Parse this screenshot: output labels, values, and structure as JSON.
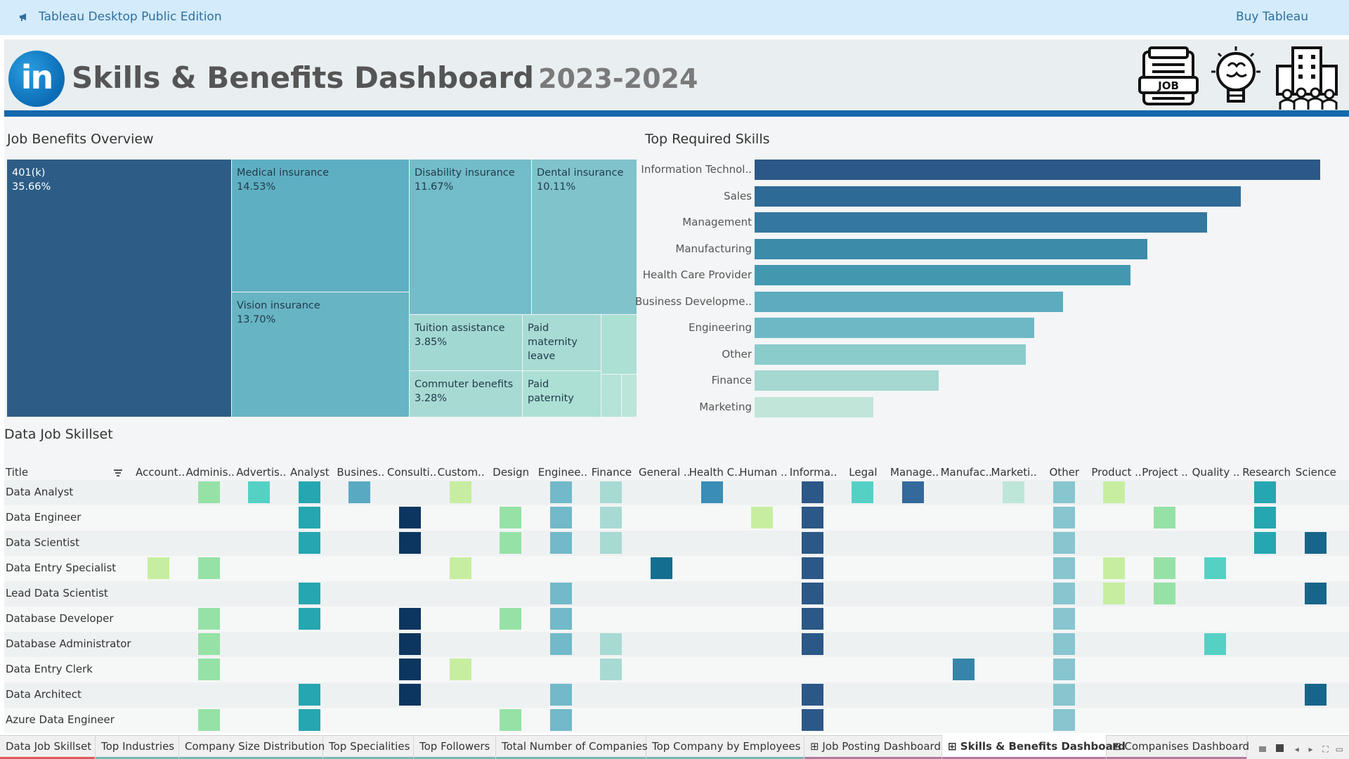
{
  "topbar": {
    "app_name": "Tableau Desktop Public Edition",
    "buy_label": "Buy Tableau"
  },
  "header": {
    "logo_text": "in",
    "title": "Skills & Benefits Dashboard",
    "years": "2023-2024",
    "icon_job_text": "JOB"
  },
  "benefits": {
    "title": "Job Benefits Overview",
    "tiles": [
      {
        "label": "401(k)",
        "value": "35.66%"
      },
      {
        "label": "Medical insurance",
        "value": "14.53%"
      },
      {
        "label": "Vision insurance",
        "value": "13.70%"
      },
      {
        "label": "Disability insurance",
        "value": "11.67%"
      },
      {
        "label": "Dental insurance",
        "value": "10.11%"
      },
      {
        "label": "Tuition assistance",
        "value": "3.85%"
      },
      {
        "label": "Commuter benefits",
        "value": "3.28%"
      },
      {
        "label": "Paid maternity leave",
        "value": ""
      },
      {
        "label": "Paid paternity",
        "value": ""
      }
    ]
  },
  "skills": {
    "title": "Top Required Skills",
    "chart_data": {
      "type": "bar",
      "orientation": "horizontal",
      "categories": [
        "Information Technol..",
        "Sales",
        "Management",
        "Manufacturing",
        "Health Care Provider",
        "Business Developme..",
        "Engineering",
        "Other",
        "Finance",
        "Marketing"
      ],
      "values": [
        100,
        86,
        80,
        69.5,
        66.5,
        54.5,
        49.5,
        48,
        32.5,
        21
      ],
      "colors": [
        "#2b5887",
        "#2e6a96",
        "#34779f",
        "#3b8ba9",
        "#4398b0",
        "#5cacbe",
        "#6eb8c5",
        "#8acbcb",
        "#a4d8d1",
        "#c1e6d9"
      ],
      "xlabel": "",
      "ylabel": "",
      "xlim": [
        0,
        100
      ],
      "grid": false
    }
  },
  "skillset": {
    "title": "Data Job Skillset",
    "title_col": "Title",
    "columns": [
      "Account..",
      "Adminis..",
      "Advertis..",
      "Analyst",
      "Busines..",
      "Consulti..",
      "Custom..",
      "Design",
      "Enginee..",
      "Finance",
      "General ..",
      "Health C..",
      "Human ..",
      "Informa..",
      "Legal",
      "Manage..",
      "Manufac..",
      "Marketi..",
      "Other",
      "Product ..",
      "Project ..",
      "Quality ..",
      "Research",
      "Science"
    ],
    "col_colors": [
      "#c7eea0",
      "#96e2a6",
      "#55d1c4",
      "#26a6b0",
      "#5aa9c3",
      "#0c3660",
      "#c7eea0",
      "#96e2a6",
      "#72b9ca",
      "#a7dad3",
      "#146e8f",
      "#3a8db6",
      "#c7eea0",
      "#2b5887",
      "#55d1c4",
      "#33699b",
      "#3685a8",
      "#bde6d9",
      "#87c5cf",
      "#c7eea0",
      "#96e2a6",
      "#55d1c4",
      "#26a6b0",
      "#17668a"
    ],
    "rows": [
      {
        "title": "Data Analyst",
        "cells": [
          1,
          2,
          3,
          4,
          6,
          8,
          9,
          11,
          13,
          14,
          15,
          17,
          18,
          19,
          22
        ]
      },
      {
        "title": "Data Engineer",
        "cells": [
          3,
          5,
          7,
          8,
          9,
          12,
          13,
          18,
          20,
          22
        ]
      },
      {
        "title": "Data Scientist",
        "cells": [
          3,
          5,
          7,
          8,
          9,
          13,
          18,
          22,
          23
        ]
      },
      {
        "title": "Data Entry Specialist",
        "cells": [
          0,
          1,
          6,
          10,
          13,
          18,
          19,
          20,
          21
        ]
      },
      {
        "title": "Lead Data Scientist",
        "cells": [
          3,
          8,
          13,
          18,
          19,
          20,
          23
        ]
      },
      {
        "title": "Database Developer",
        "cells": [
          1,
          3,
          5,
          7,
          8,
          13,
          18
        ]
      },
      {
        "title": "Database Administrator",
        "cells": [
          1,
          5,
          8,
          9,
          13,
          18,
          21
        ]
      },
      {
        "title": "Data Entry Clerk",
        "cells": [
          1,
          5,
          6,
          9,
          16,
          18
        ]
      },
      {
        "title": "Data Architect",
        "cells": [
          3,
          5,
          8,
          13,
          18,
          23
        ]
      },
      {
        "title": "Azure Data Engineer",
        "cells": [
          1,
          3,
          7,
          8,
          13,
          18
        ]
      }
    ]
  },
  "tabs": [
    {
      "label": "Data Job Skillset",
      "color": "#e15759"
    },
    {
      "label": "Top Industries",
      "color": "#76b7b2"
    },
    {
      "label": "Company Size Distribution",
      "color": "#76b7b2"
    },
    {
      "label": "Top Specialities",
      "color": "#76b7b2"
    },
    {
      "label": "Top Followers",
      "color": "#76b7b2"
    },
    {
      "label": "Total Number of Companies",
      "color": "#76b7b2"
    },
    {
      "label": "Top Company by Employees",
      "color": "#76b7b2"
    },
    {
      "label": "Job Posting Dashboard",
      "color": "#b07aa1"
    },
    {
      "label": "Skills & Benefits Dashboard",
      "color": "#b07aa1"
    },
    {
      "label": "Companises Dashboard",
      "color": "#b07aa1"
    }
  ]
}
